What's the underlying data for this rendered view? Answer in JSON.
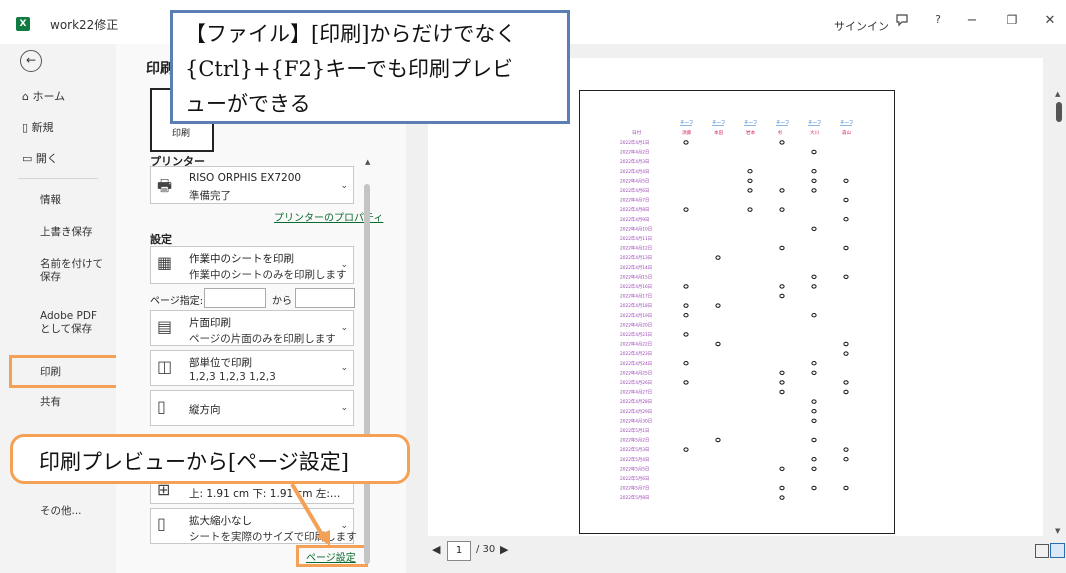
{
  "titlebar": {
    "app_icon": "X",
    "workbook": "work22修正",
    "signin": "サインイン",
    "icons": [
      "comment-icon",
      "help-icon",
      "minimize-icon",
      "restore-icon",
      "close-icon"
    ],
    "help": "?",
    "minimize": "−",
    "restore": "❐",
    "close": "✕"
  },
  "nav": {
    "back": "←",
    "items": [
      {
        "label": "ホーム",
        "icon": "home-icon"
      },
      {
        "label": "新規",
        "icon": "new-icon"
      },
      {
        "label": "開く",
        "icon": "folder-icon"
      }
    ],
    "subitems": [
      "情報",
      "上書き保存",
      "名前を付けて保存",
      "Adobe PDF として保存",
      "印刷",
      "共有"
    ],
    "more": "その他..."
  },
  "panel": {
    "title": "印刷",
    "print_button": "印刷",
    "printer_heading": "プリンター",
    "printer_name": "RISO ORPHIS EX7200",
    "printer_status": "準備完了",
    "printer_props": "プリンターのプロパティ",
    "settings_heading": "設定",
    "opt_sheet_1": "作業中のシートを印刷",
    "opt_sheet_2": "作業中のシートのみを印刷します",
    "pages_label": "ページ指定:",
    "pages_to": "から",
    "opt_side_1": "片面印刷",
    "opt_side_2": "ページの片面のみを印刷します",
    "opt_collate_1": "部単位で印刷",
    "opt_collate_2": "1,2,3    1,2,3    1,2,3",
    "opt_orient": "縦方向",
    "opt_margin": "上: 1.91 cm 下: 1.91 cm 左:…",
    "opt_scale_1": "拡大縮小なし",
    "opt_scale_2": "シートを実際のサイズで印刷します",
    "page_setup": "ページ設定"
  },
  "preview": {
    "current_page": "1",
    "total_pages": "/ 30",
    "sheet": {
      "header_top": [
        "チーフ",
        "チーフ",
        "チーフ",
        "チーフ",
        "チーフ",
        "チーフ"
      ],
      "date_header": "日付",
      "names": [
        "須藤",
        "本田",
        "岩本",
        "杉",
        "大川",
        "森山"
      ],
      "dates": [
        "2022年4月1日",
        "2022年4月2日",
        "2022年4月3日",
        "2022年4月4日",
        "2022年4月5日",
        "2022年4月6日",
        "2022年4月7日",
        "2022年4月8日",
        "2022年4月9日",
        "2022年4月10日",
        "2022年4月11日",
        "2022年4月12日",
        "2022年4月13日",
        "2022年4月14日",
        "2022年4月15日",
        "2022年4月16日",
        "2022年4月17日",
        "2022年4月18日",
        "2022年4月19日",
        "2022年4月20日",
        "2022年4月21日",
        "2022年4月22日",
        "2022年4月23日",
        "2022年4月24日",
        "2022年4月25日",
        "2022年4月26日",
        "2022年4月27日",
        "2022年4月28日",
        "2022年4月29日",
        "2022年4月30日",
        "2022年5月1日",
        "2022年5月2日",
        "2022年5月3日",
        "2022年5月4日",
        "2022年5月5日",
        "2022年5月6日",
        "2022年5月7日",
        "2022年5月8日"
      ],
      "marks": [
        [
          1,
          0,
          0,
          1,
          0,
          0
        ],
        [
          0,
          0,
          0,
          0,
          1,
          0
        ],
        [
          0,
          0,
          0,
          0,
          0,
          0
        ],
        [
          0,
          0,
          1,
          0,
          1,
          0
        ],
        [
          0,
          0,
          1,
          0,
          1,
          1
        ],
        [
          0,
          0,
          1,
          1,
          1,
          0
        ],
        [
          0,
          0,
          0,
          0,
          0,
          1
        ],
        [
          1,
          0,
          1,
          1,
          0,
          0
        ],
        [
          0,
          0,
          0,
          0,
          0,
          1
        ],
        [
          0,
          0,
          0,
          0,
          1,
          0
        ],
        [
          0,
          0,
          0,
          0,
          0,
          0
        ],
        [
          0,
          0,
          0,
          1,
          0,
          1
        ],
        [
          0,
          1,
          0,
          0,
          0,
          0
        ],
        [
          0,
          0,
          0,
          0,
          0,
          0
        ],
        [
          0,
          0,
          0,
          0,
          1,
          1
        ],
        [
          1,
          0,
          0,
          1,
          1,
          0
        ],
        [
          0,
          0,
          0,
          1,
          0,
          0
        ],
        [
          1,
          1,
          0,
          0,
          0,
          0
        ],
        [
          1,
          0,
          0,
          0,
          1,
          0
        ],
        [
          0,
          0,
          0,
          0,
          0,
          0
        ],
        [
          1,
          0,
          0,
          0,
          0,
          0
        ],
        [
          0,
          1,
          0,
          0,
          0,
          1
        ],
        [
          0,
          0,
          0,
          0,
          0,
          1
        ],
        [
          1,
          0,
          0,
          0,
          1,
          0
        ],
        [
          0,
          0,
          0,
          1,
          1,
          0
        ],
        [
          1,
          0,
          0,
          1,
          0,
          1
        ],
        [
          0,
          0,
          0,
          1,
          0,
          1
        ],
        [
          0,
          0,
          0,
          0,
          1,
          0
        ],
        [
          0,
          0,
          0,
          0,
          1,
          0
        ],
        [
          0,
          0,
          0,
          0,
          1,
          0
        ],
        [
          0,
          0,
          0,
          0,
          0,
          0
        ],
        [
          0,
          1,
          0,
          0,
          1,
          0
        ],
        [
          1,
          0,
          0,
          0,
          0,
          1
        ],
        [
          0,
          0,
          0,
          0,
          1,
          1
        ],
        [
          0,
          0,
          0,
          1,
          1,
          0
        ],
        [
          0,
          0,
          0,
          0,
          0,
          0
        ],
        [
          0,
          0,
          0,
          1,
          1,
          1
        ],
        [
          0,
          0,
          0,
          1,
          0,
          0
        ]
      ]
    }
  },
  "callouts": {
    "shortcut_1": "【ファイル】[印刷]からだけでなく",
    "shortcut_2": "{Ctrl}+{F2}キーでも印刷プレビ",
    "shortcut_3": "ューができる",
    "page_setup_note": "印刷プレビューから[ページ設定]"
  },
  "colors": {
    "accent_orange": "#f5a155",
    "callout_blue": "#5b7fb5",
    "excel_green": "#107c41",
    "date_purple": "#9b3fb5",
    "header_blue": "#1a6fc0",
    "name_red": "#d0306c"
  }
}
